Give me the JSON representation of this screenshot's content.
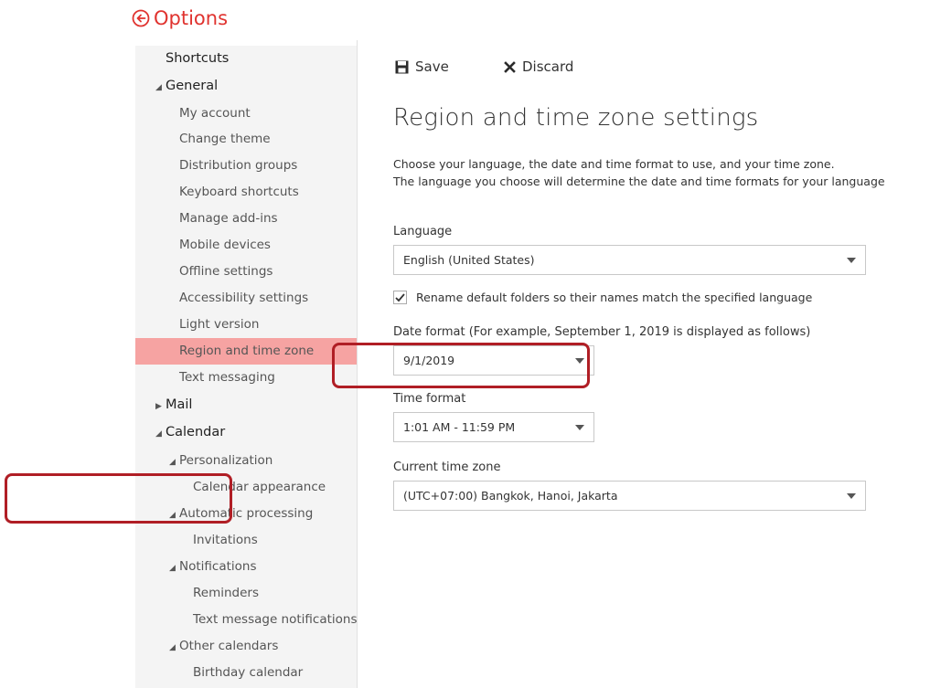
{
  "header": {
    "title": "Options"
  },
  "toolbar": {
    "save_label": "Save",
    "discard_label": "Discard"
  },
  "sidebar": {
    "items": [
      {
        "label": "Shortcuts"
      },
      {
        "label": "General"
      },
      {
        "label": "My account"
      },
      {
        "label": "Change theme"
      },
      {
        "label": "Distribution groups"
      },
      {
        "label": "Keyboard shortcuts"
      },
      {
        "label": "Manage add-ins"
      },
      {
        "label": "Mobile devices"
      },
      {
        "label": "Offline settings"
      },
      {
        "label": "Accessibility settings"
      },
      {
        "label": "Light version"
      },
      {
        "label": "Region and time zone"
      },
      {
        "label": "Text messaging"
      },
      {
        "label": "Mail"
      },
      {
        "label": "Calendar"
      },
      {
        "label": "Personalization"
      },
      {
        "label": "Calendar appearance"
      },
      {
        "label": "Automatic processing"
      },
      {
        "label": "Invitations"
      },
      {
        "label": "Notifications"
      },
      {
        "label": "Reminders"
      },
      {
        "label": "Text message notifications"
      },
      {
        "label": "Other calendars"
      },
      {
        "label": "Birthday calendar"
      }
    ]
  },
  "main": {
    "title": "Region and time zone settings",
    "description_line1": "Choose your language, the date and time format to use, and your time zone.",
    "description_line2": "The language you choose will determine the date and time formats for your language",
    "language_label": "Language",
    "language_value": "English (United States)",
    "rename_label": "Rename default folders so their names match the specified language",
    "rename_checked": true,
    "date_format_label": "Date format (For example, September 1, 2019 is displayed as follows)",
    "date_format_value": "9/1/2019",
    "time_format_label": "Time format",
    "time_format_value": "1:01 AM - 11:59 PM",
    "time_zone_label": "Current time zone",
    "time_zone_value": "(UTC+07:00) Bangkok, Hanoi, Jakarta"
  },
  "colors": {
    "accent": "#e0332f",
    "selected_bg": "#f6a3a2",
    "annotation": "#b01e25",
    "sidebar_bg": "#f4f4f4"
  }
}
